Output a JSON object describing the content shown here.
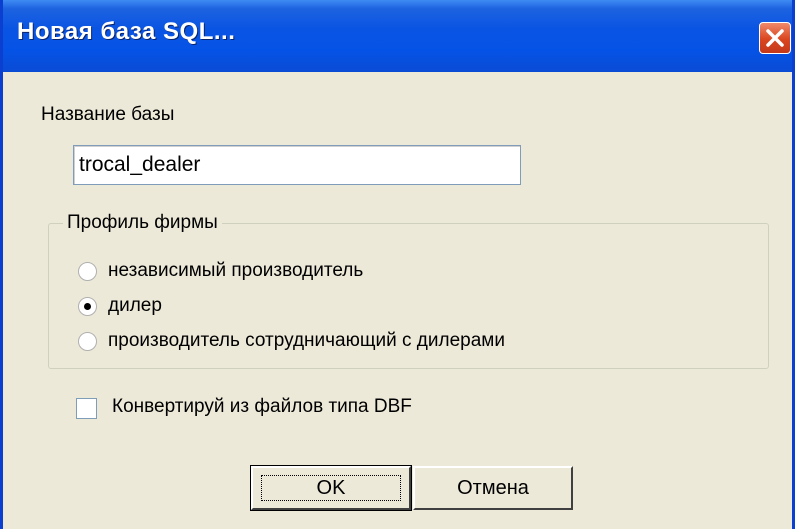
{
  "window": {
    "title": "Новая база SQL..."
  },
  "database": {
    "label": "Название базы",
    "value": "trocal_dealer"
  },
  "profile": {
    "legend": "Профиль фирмы",
    "options": [
      {
        "label": "независимый производитель",
        "selected": false
      },
      {
        "label": "дилер",
        "selected": true
      },
      {
        "label": "производитель сотрудничающий с дилерами",
        "selected": false
      }
    ]
  },
  "convert": {
    "label": "Конвертируй из файлов типа DBF",
    "checked": false
  },
  "buttons": {
    "ok": "OK",
    "cancel": "Отмена"
  },
  "colors": {
    "titlebar": "#0553e6",
    "close": "#d9461f",
    "face": "#ece9d8"
  },
  "icons": {
    "close": "close-icon"
  }
}
